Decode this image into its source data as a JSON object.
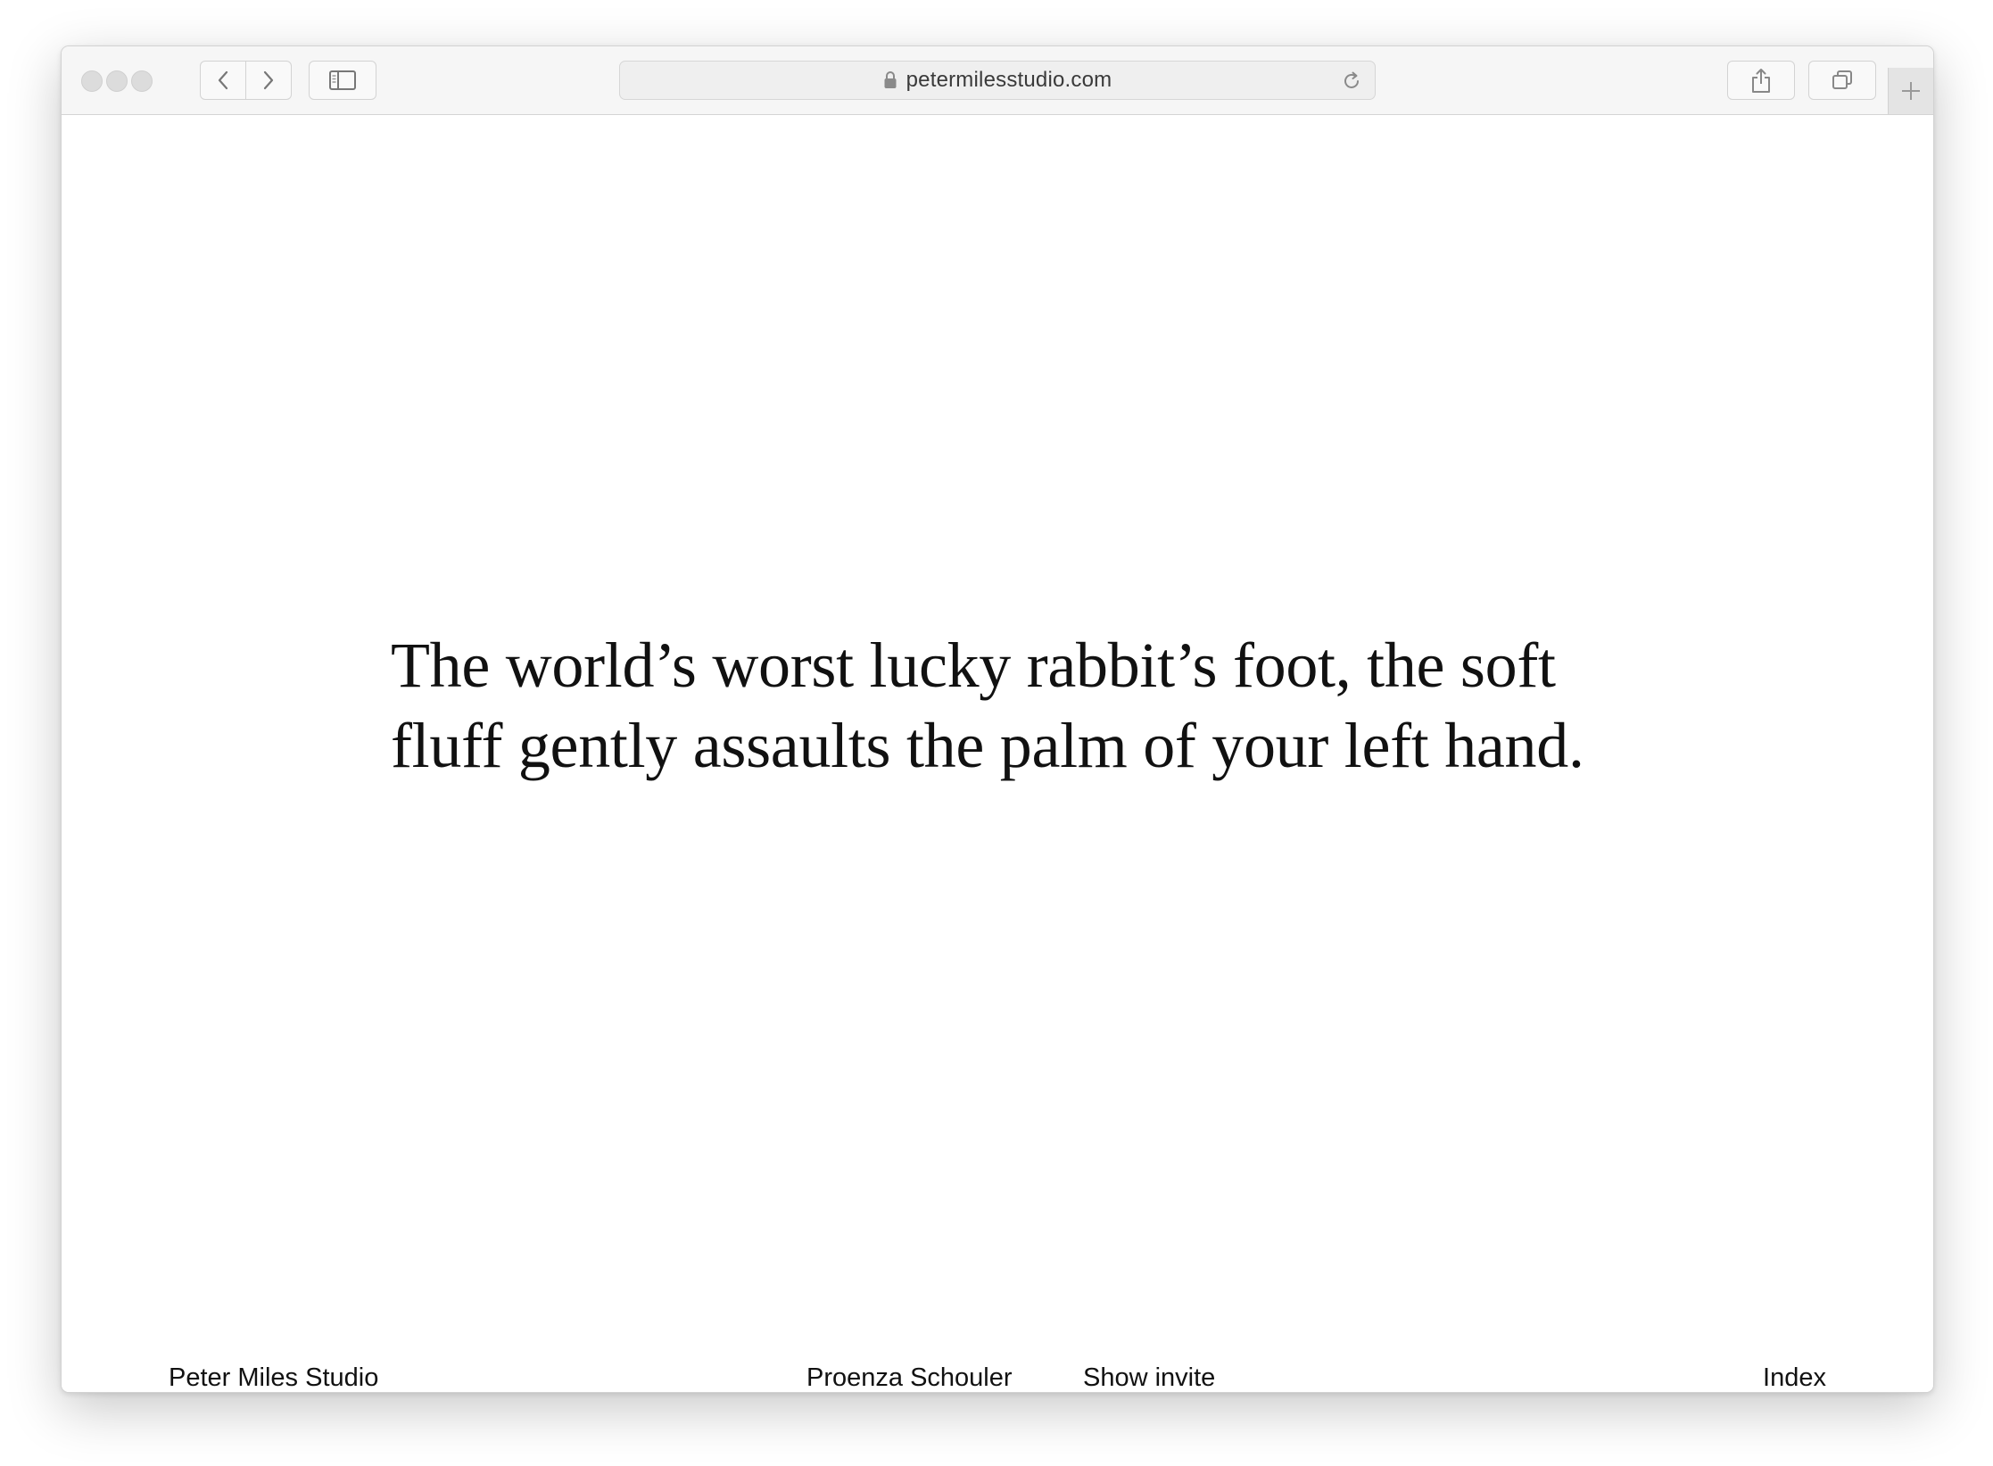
{
  "browser": {
    "address_bar": {
      "url": "petermilesstudio.com",
      "secure": true
    },
    "icons": {
      "close": "traffic-light-close",
      "minimize": "traffic-light-minimize",
      "zoom": "traffic-light-zoom",
      "back": "chevron-left-icon",
      "forward": "chevron-right-icon",
      "sidebar": "sidebar-icon",
      "lock": "lock-icon",
      "reload": "reload-icon",
      "share": "share-icon",
      "tabs": "tabs-overview-icon",
      "new_tab": "plus-icon"
    }
  },
  "page": {
    "headline": "The world’s worst lucky rabbit’s foot, the soft fluff gently assaults the palm of your left hand.",
    "footer": {
      "studio_name": "Peter Miles Studio",
      "client": "Proenza Schouler",
      "project": "Show invite",
      "index": "Index"
    }
  },
  "colors": {
    "text": "#111111",
    "toolbar_bg": "#f6f6f6",
    "page_bg": "#ffffff"
  }
}
